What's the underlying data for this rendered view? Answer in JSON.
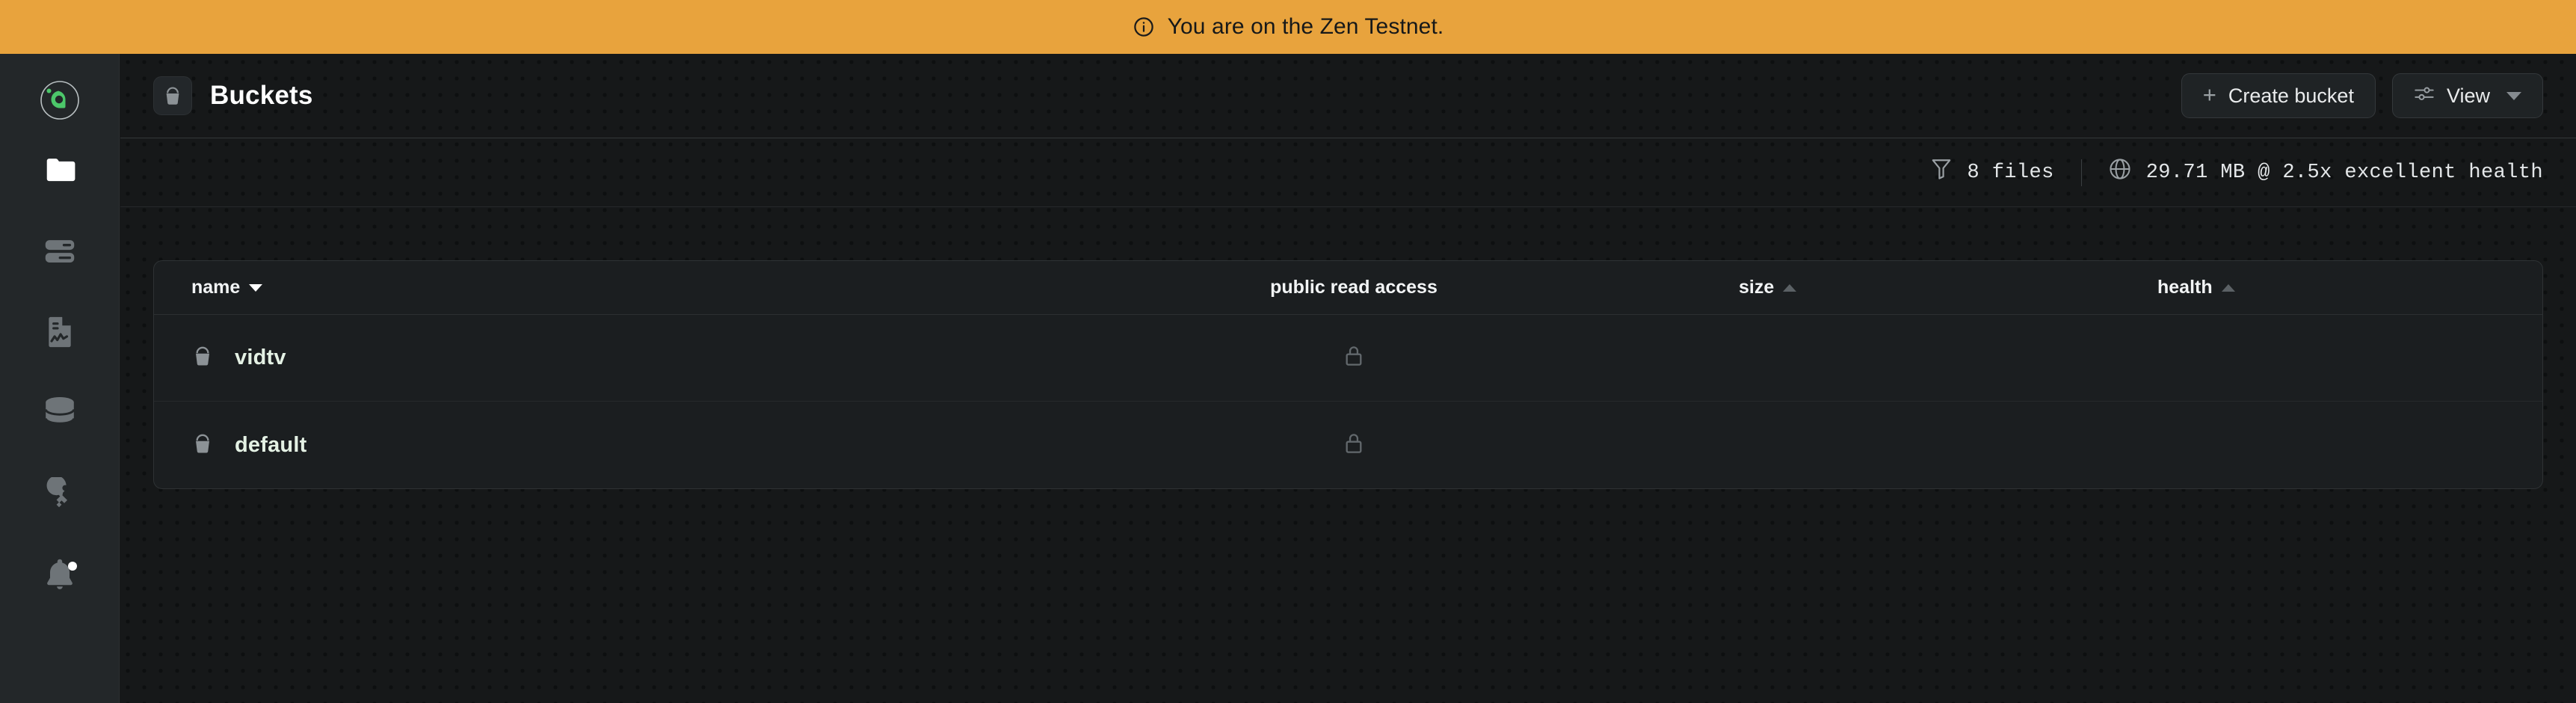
{
  "banner": {
    "icon": "info-circle-icon",
    "text": "You are on the Zen Testnet.",
    "color": "#e8a33d"
  },
  "sidebar": {
    "logo": {
      "name": "app-logo",
      "color": "#4cc76a"
    },
    "items": [
      {
        "icon": "folder-icon",
        "name": "sidebar-item-buckets",
        "active": true
      },
      {
        "icon": "server-icon",
        "name": "sidebar-item-servers",
        "active": false
      },
      {
        "icon": "report-icon",
        "name": "sidebar-item-reports",
        "active": false
      },
      {
        "icon": "database-icon",
        "name": "sidebar-item-storage",
        "active": false
      },
      {
        "icon": "key-icon",
        "name": "sidebar-item-keys",
        "active": false
      },
      {
        "icon": "bell-icon",
        "name": "sidebar-item-notifications",
        "active": false,
        "badge": true
      }
    ]
  },
  "header": {
    "icon": "bucket-icon",
    "title": "Buckets",
    "create_button": {
      "label": "Create bucket",
      "icon": "plus-icon"
    },
    "view_button": {
      "label": "View",
      "icon": "sliders-icon",
      "caret": "chevron-down-icon"
    }
  },
  "stats": {
    "files": {
      "icon": "filter-icon",
      "text": "8 files"
    },
    "usage": {
      "icon": "globe-icon",
      "text": "29.71 MB @ 2.5x  excellent health"
    }
  },
  "table": {
    "columns": [
      {
        "label": "name",
        "sort": "desc"
      },
      {
        "label": "public read access",
        "sort": "none"
      },
      {
        "label": "size",
        "sort": "asc"
      },
      {
        "label": "health",
        "sort": "asc"
      }
    ],
    "rows": [
      {
        "icon": "bucket-icon",
        "name": "vidtv",
        "access_icon": "lock-closed-icon",
        "size": "",
        "health": ""
      },
      {
        "icon": "bucket-icon",
        "name": "default",
        "access_icon": "lock-closed-icon",
        "size": "",
        "health": ""
      }
    ]
  },
  "theme": {
    "background": "#161819",
    "sidebar": "#232729",
    "panel": "#1b1e20",
    "accent_green": "#4cc76a",
    "icon_gray": "#6e7478"
  }
}
